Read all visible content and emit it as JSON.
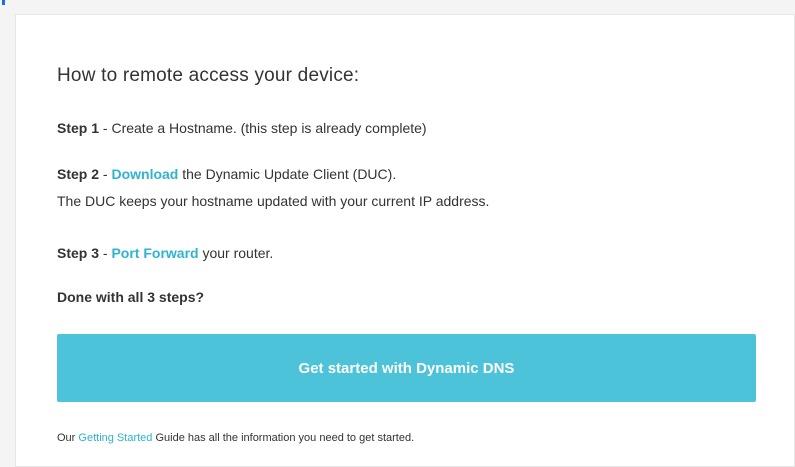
{
  "heading": "How to remote access your device:",
  "step1": {
    "label": "Step 1",
    "text": " - Create a Hostname. (this step is already complete)"
  },
  "step2": {
    "label": "Step 2",
    "sep": " - ",
    "link": "Download",
    "text": " the Dynamic Update Client (DUC).",
    "note": "The DUC keeps your hostname updated with your current IP address."
  },
  "step3": {
    "label": "Step 3",
    "sep": " - ",
    "link": "Port Forward",
    "text": " your router."
  },
  "done_question": "Done with all 3 steps?",
  "cta_label": "Get started with Dynamic DNS",
  "footer": {
    "prefix": "Our ",
    "link": "Getting Started",
    "suffix": " Guide has all the information you need to get started."
  },
  "colors": {
    "accent": "#4cc3d9",
    "link": "#2fb3cf",
    "text": "#333333"
  }
}
